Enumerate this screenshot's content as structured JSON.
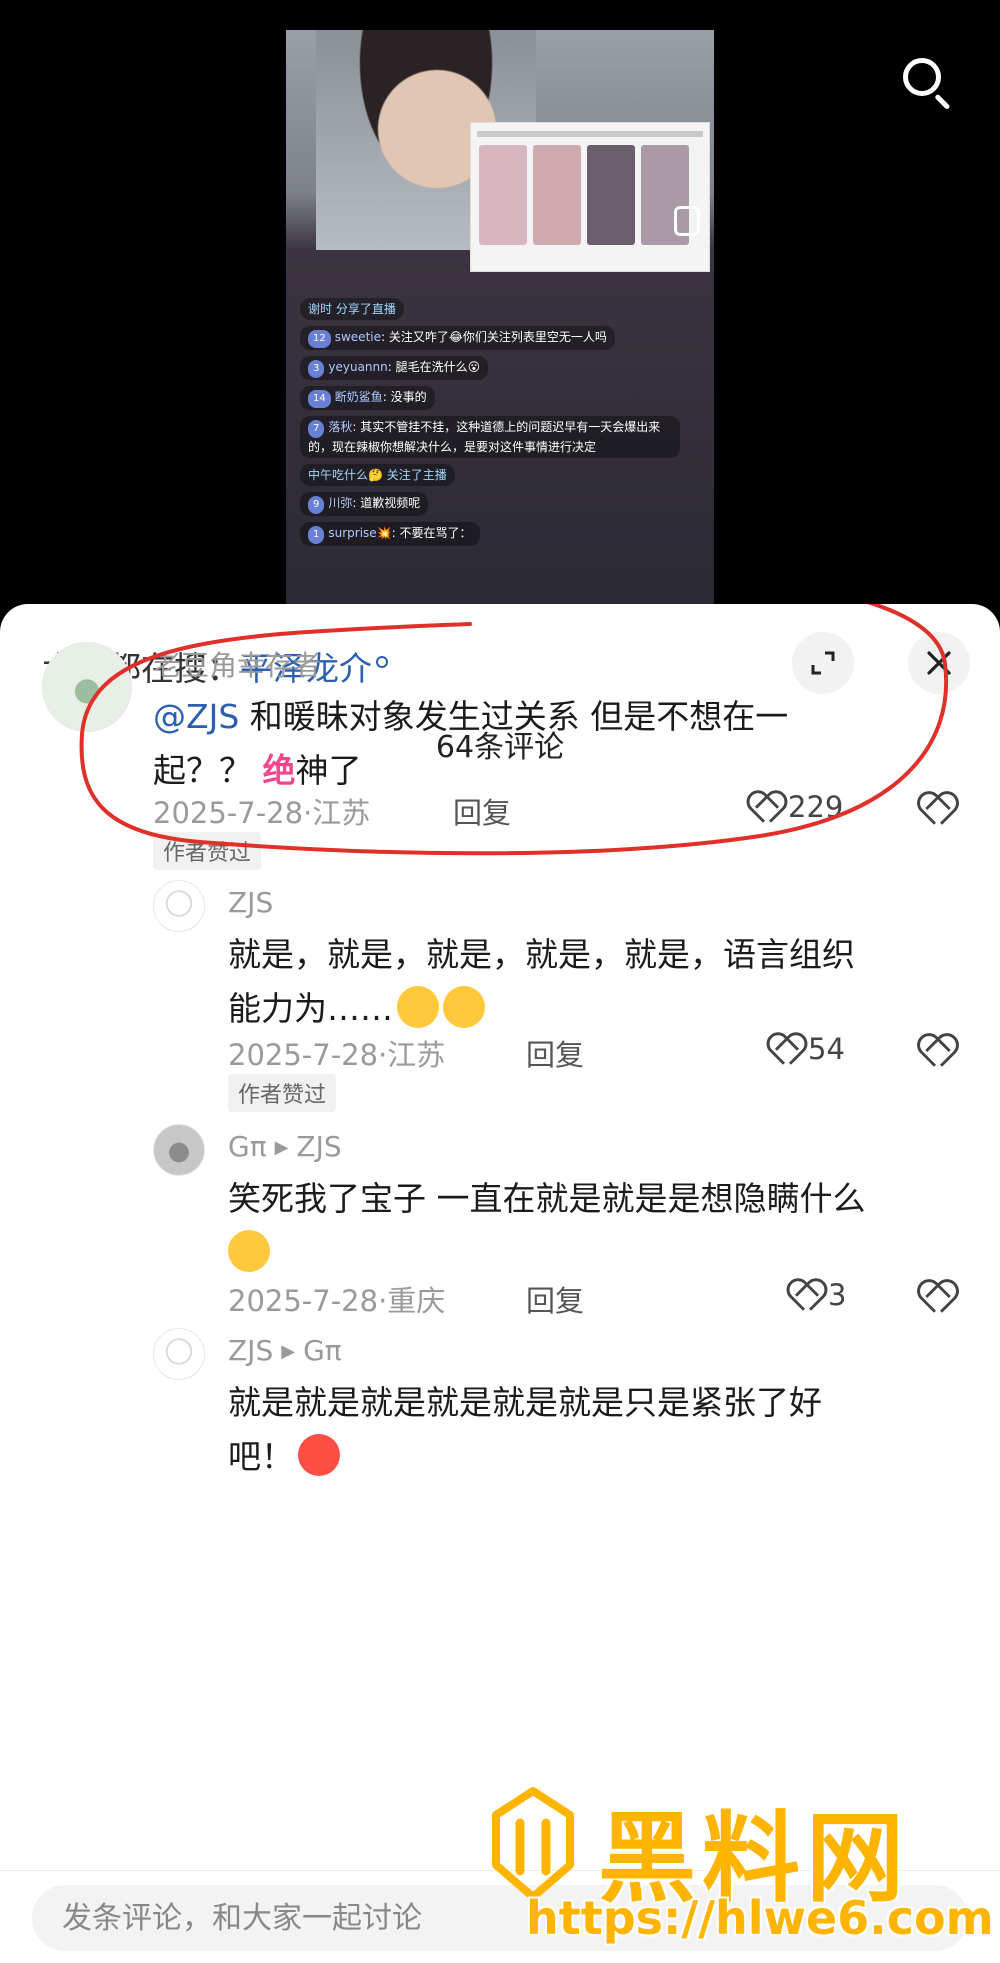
{
  "live_chat": [
    {
      "kind": "system",
      "name": "谢时",
      "text": "分享了直播"
    },
    {
      "kind": "msg",
      "level": "12",
      "name": "sweetie",
      "text": "关注又咋了😂你们关注列表里空无一人吗"
    },
    {
      "kind": "msg",
      "level": "3",
      "name": "yeyuannn",
      "text": "腿毛在洗什么😮"
    },
    {
      "kind": "msg",
      "level": "14",
      "name": "断奶鲨鱼",
      "text": "没事的"
    },
    {
      "kind": "msg",
      "level": "7",
      "name": "落秋",
      "text": "其实不管挂不挂，这种道德上的问题迟早有一天会爆出来的，现在辣椒你想解决什么，是要对这件事情进行决定"
    },
    {
      "kind": "system",
      "name": "中午吃什么🤔",
      "text": "关注了主播"
    },
    {
      "kind": "msg",
      "level": "9",
      "name": "川弥",
      "text": "道歉视频呢"
    },
    {
      "kind": "msg",
      "level": "1",
      "name": "surprise💥",
      "text": "不要在骂了："
    }
  ],
  "trending": {
    "prefix": "大家都在搜：",
    "term": "平泽龙介"
  },
  "comment_count": "64条评论",
  "comments": [
    {
      "username": "老豆角幸存者",
      "mention": "@ZJS",
      "text_line1": "和暖昧对象发生过关系 但是不想在一",
      "text_line2_pre": "起？？",
      "hot_word": "绝",
      "text_line2_post": "神了",
      "date_location": "2025-7-28·江苏",
      "reply": "回复",
      "likes": "229",
      "badge": "作者赞过"
    },
    {
      "username": "ZJS",
      "text_line1": "就是，就是，就是，就是，就是，语言组织",
      "text_line2": "能力为……",
      "date_location": "2025-7-28·江苏",
      "reply": "回复",
      "likes": "54",
      "badge": "作者赞过"
    },
    {
      "username": "Gπ",
      "reply_to": "ZJS",
      "text_line1": "笑死我了宝子 一直在就是就是是想隐瞒什么",
      "date_location": "2025-7-28·重庆",
      "reply": "回复",
      "likes": "3"
    },
    {
      "username": "ZJS",
      "reply_to": "Gπ",
      "text_line1": "就是就是就是就是就是就是只是紧张了好",
      "text_line2": "吧！"
    }
  ],
  "input": {
    "placeholder": "发条评论，和大家一起讨论"
  },
  "watermark": {
    "title": "黑料网",
    "url": "https://hlwe6.com"
  },
  "colors": {
    "mention": "#2c5fb0",
    "hot_word": "#f1458e",
    "annotation": "#e0302a",
    "watermark": "#ffb400"
  }
}
